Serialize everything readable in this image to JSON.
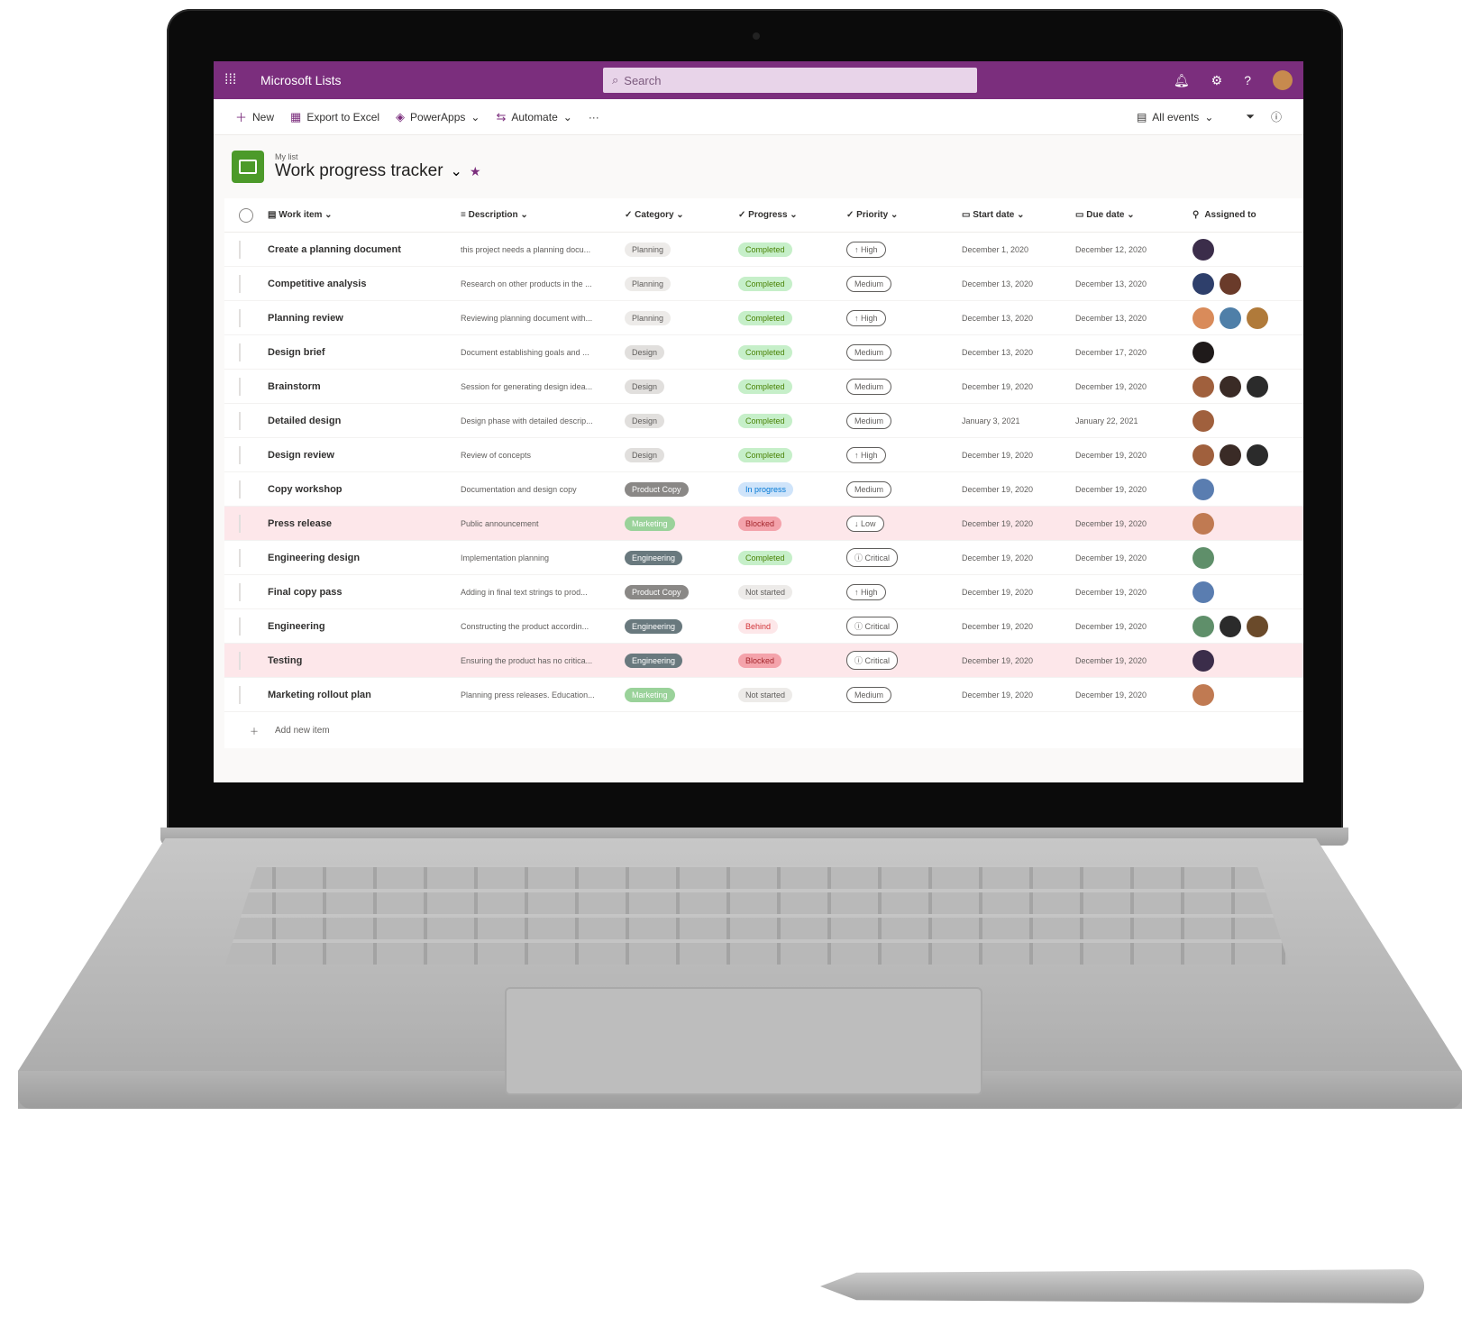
{
  "suitebar": {
    "waffle_icon": "waffle-icon",
    "app_name": "Microsoft Lists",
    "search_placeholder": "Search",
    "icons": [
      "bell-icon",
      "gear-icon",
      "help-icon"
    ],
    "color": "#7b2e7d"
  },
  "commandbar": {
    "new_label": "New",
    "export_label": "Export to Excel",
    "powerapps_label": "PowerApps",
    "automate_label": "Automate",
    "more_label": "···",
    "view_label": "All events"
  },
  "list": {
    "parent_label": "My list",
    "title": "Work progress tracker"
  },
  "columns": {
    "item": "Work item",
    "description": "Description",
    "category": "Category",
    "progress": "Progress",
    "priority": "Priority",
    "start": "Start date",
    "due": "Due date",
    "assigned": "Assigned to"
  },
  "rows": [
    {
      "item": "Create a planning document",
      "description": "this project needs a planning docu...",
      "category": "Planning",
      "progress": "Completed",
      "priority": "↑ High",
      "start": "December 1, 2020",
      "due": "December 12, 2020",
      "avatars": [
        "#3b2d4a"
      ],
      "flagged": false
    },
    {
      "item": "Competitive analysis",
      "description": "Research on other products in the ...",
      "category": "Planning",
      "progress": "Completed",
      "priority": "Medium",
      "start": "December 13, 2020",
      "due": "December 13, 2020",
      "avatars": [
        "#2e3f6b",
        "#6a3b2a"
      ],
      "flagged": false
    },
    {
      "item": "Planning review",
      "description": "Reviewing planning document with...",
      "category": "Planning",
      "progress": "Completed",
      "priority": "↑ High",
      "start": "December 13, 2020",
      "due": "December 13, 2020",
      "avatars": [
        "#d98b5a",
        "#4f7fa8",
        "#b07a3a"
      ],
      "flagged": false
    },
    {
      "item": "Design brief",
      "description": "Document establishing goals and ...",
      "category": "Design",
      "progress": "Completed",
      "priority": "Medium",
      "start": "December 13, 2020",
      "due": "December 17, 2020",
      "avatars": [
        "#1f1a1a"
      ],
      "flagged": false
    },
    {
      "item": "Brainstorm",
      "description": "Session for generating design idea...",
      "category": "Design",
      "progress": "Completed",
      "priority": "Medium",
      "start": "December 19, 2020",
      "due": "December 19, 2020",
      "avatars": [
        "#a0603d",
        "#3a2b26",
        "#2b2b2b"
      ],
      "flagged": false
    },
    {
      "item": "Detailed design",
      "description": "Design phase with detailed descrip...",
      "category": "Design",
      "progress": "Completed",
      "priority": "Medium",
      "start": "January 3, 2021",
      "due": "January 22, 2021",
      "avatars": [
        "#a0603d"
      ],
      "flagged": false
    },
    {
      "item": "Design review",
      "description": "Review of concepts",
      "category": "Design",
      "progress": "Completed",
      "priority": "↑ High",
      "start": "December 19, 2020",
      "due": "December 19, 2020",
      "avatars": [
        "#a0603d",
        "#3a2b26",
        "#2b2b2b"
      ],
      "flagged": false
    },
    {
      "item": "Copy workshop",
      "description": "Documentation and design copy",
      "category": "Product Copy",
      "progress": "In progress",
      "priority": "Medium",
      "start": "December 19, 2020",
      "due": "December 19, 2020",
      "avatars": [
        "#5a7db0"
      ],
      "flagged": false
    },
    {
      "item": "Press release",
      "description": "Public announcement",
      "category": "Marketing",
      "progress": "Blocked",
      "priority": "↓ Low",
      "start": "December 19, 2020",
      "due": "December 19, 2020",
      "avatars": [
        "#c07a52"
      ],
      "flagged": true
    },
    {
      "item": "Engineering design",
      "description": "Implementation planning",
      "category": "Engineering",
      "progress": "Completed",
      "priority": "ⓘ Critical",
      "start": "December 19, 2020",
      "due": "December 19, 2020",
      "avatars": [
        "#5f8f6a"
      ],
      "flagged": false
    },
    {
      "item": "Final copy pass",
      "description": "Adding in final text strings to prod...",
      "category": "Product Copy",
      "progress": "Not started",
      "priority": "↑ High",
      "start": "December 19, 2020",
      "due": "December 19, 2020",
      "avatars": [
        "#5a7db0"
      ],
      "flagged": false
    },
    {
      "item": "Engineering",
      "description": "Constructing the product accordin...",
      "category": "Engineering",
      "progress": "Behind",
      "priority": "ⓘ Critical",
      "start": "December 19, 2020",
      "due": "December 19, 2020",
      "avatars": [
        "#5f8f6a",
        "#2b2b2b",
        "#6a4a2a"
      ],
      "flagged": false
    },
    {
      "item": "Testing",
      "description": "Ensuring the product has no critica...",
      "category": "Engineering",
      "progress": "Blocked",
      "priority": "ⓘ Critical",
      "start": "December 19, 2020",
      "due": "December 19, 2020",
      "avatars": [
        "#3b2d4a"
      ],
      "flagged": true
    },
    {
      "item": "Marketing rollout plan",
      "description": "Planning press releases. Education...",
      "category": "Marketing",
      "progress": "Not started",
      "priority": "Medium",
      "start": "December 19, 2020",
      "due": "December 19, 2020",
      "avatars": [
        "#c07a52"
      ],
      "flagged": false
    }
  ],
  "add_new_label": "Add new item",
  "category_colors": {
    "Planning": {
      "bg": "#edebe9",
      "fg": "#605e5c"
    },
    "Design": {
      "bg": "#e1dfdd",
      "fg": "#605e5c"
    },
    "Product Copy": {
      "bg": "#8a8886",
      "fg": "#ffffff"
    },
    "Marketing": {
      "bg": "#9ad29a",
      "fg": "#ffffff"
    },
    "Engineering": {
      "bg": "#69797e",
      "fg": "#ffffff"
    }
  },
  "progress_colors": {
    "Completed": {
      "bg": "#c6efc9",
      "fg": "#498205"
    },
    "In progress": {
      "bg": "#cfe4fa",
      "fg": "#0078d4"
    },
    "Blocked": {
      "bg": "#f4a3ab",
      "fg": "#a4262c"
    },
    "Not started": {
      "bg": "#edebe9",
      "fg": "#605e5c"
    },
    "Behind": {
      "bg": "#fde7e9",
      "fg": "#d13438"
    }
  }
}
